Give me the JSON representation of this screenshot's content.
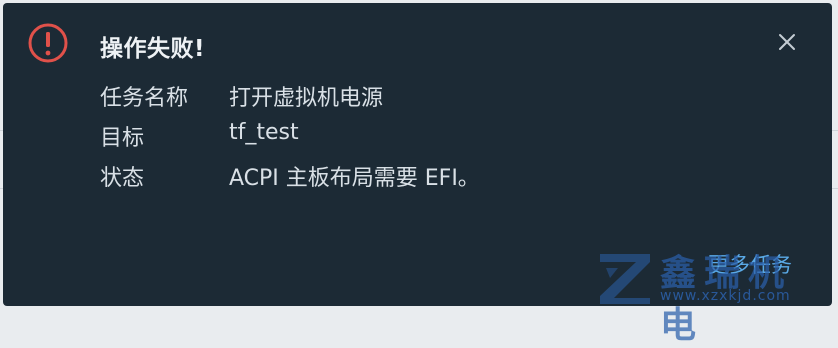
{
  "notification": {
    "title": "操作失败!",
    "rows": [
      {
        "label": "任务名称",
        "value": "打开虚拟机电源"
      },
      {
        "label": "目标",
        "value": "tf_test"
      },
      {
        "label": "状态",
        "value": "ACPI 主板布局需要 EFI。"
      }
    ],
    "more_link": "更多任务",
    "icons": {
      "status": "error-circle-icon",
      "close": "close-icon"
    },
    "colors": {
      "background": "#1c2a35",
      "error": "#e0514a",
      "text": "#d9e0e6",
      "link": "#5aa9e6"
    }
  },
  "watermark": {
    "text": "鑫瑞机电",
    "url": "www.xzxkjd.com"
  }
}
